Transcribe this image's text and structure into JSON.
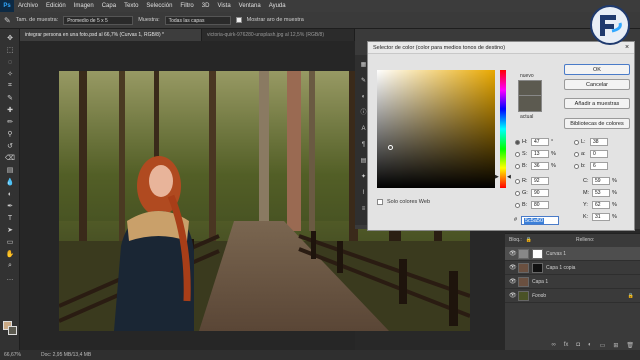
{
  "menu": [
    "Archivo",
    "Edición",
    "Imagen",
    "Capa",
    "Texto",
    "Selección",
    "Filtro",
    "3D",
    "Vista",
    "Ventana",
    "Ayuda"
  ],
  "options_bar": {
    "sample_size_label": "Tam. de muestra:",
    "sample_size_value": "Promedio de 5 x 5",
    "sample_label": "Muestra:",
    "sample_value": "Todas las capas",
    "ring_label": "Mostrar aro de muestra"
  },
  "tabs": [
    "integrar persona en una foto.psd al 66,7% (Curvas 1, RGB/8) *",
    "victoria-quirk-976280-unsplash.jpg al 12,5% (RGB/8)"
  ],
  "status": {
    "zoom": "66,67%",
    "doc": "Doc: 2,95 MB/13,4 MB"
  },
  "color_picker": {
    "title": "Selector de color (color para medios tonos de destino)",
    "new_label": "nuevo",
    "current_label": "actual",
    "buttons": {
      "ok": "OK",
      "cancel": "Cancelar",
      "add_swatch": "Añadir a muestras",
      "libraries": "Bibliotecas de colores"
    },
    "web_only": "Solo colores Web",
    "fields": {
      "H": {
        "label": "H:",
        "value": "47",
        "unit": "°"
      },
      "S": {
        "label": "S:",
        "value": "13",
        "unit": "%"
      },
      "B": {
        "label": "B:",
        "value": "36",
        "unit": "%"
      },
      "R": {
        "label": "R:",
        "value": "92",
        "unit": ""
      },
      "G": {
        "label": "G:",
        "value": "90",
        "unit": ""
      },
      "Bb": {
        "label": "B:",
        "value": "80",
        "unit": ""
      },
      "L": {
        "label": "L:",
        "value": "38",
        "unit": ""
      },
      "a": {
        "label": "a:",
        "value": "0",
        "unit": ""
      },
      "b": {
        "label": "b:",
        "value": "6",
        "unit": ""
      },
      "C": {
        "label": "C:",
        "value": "59",
        "unit": "%"
      },
      "M": {
        "label": "M:",
        "value": "53",
        "unit": "%"
      },
      "Y": {
        "label": "Y:",
        "value": "62",
        "unit": "%"
      },
      "K": {
        "label": "K:",
        "value": "31",
        "unit": "%"
      }
    },
    "hex_label": "#",
    "hex_value": "5c5a50",
    "new_color": "#5c5a50",
    "hue_color": "#e8a800"
  },
  "layers": {
    "kind_label": "Bloq.:",
    "fill_label": "Relleno:",
    "items": [
      {
        "name": "Curvas 1",
        "selected": true
      },
      {
        "name": "Capa 1 copia",
        "selected": false
      },
      {
        "name": "Capa 1",
        "selected": false
      },
      {
        "name": "Fondo",
        "selected": false
      }
    ]
  },
  "colors": {
    "accent": "#31a8ff",
    "panel": "#3a3a3a",
    "dialog": "#e3e3e3"
  }
}
